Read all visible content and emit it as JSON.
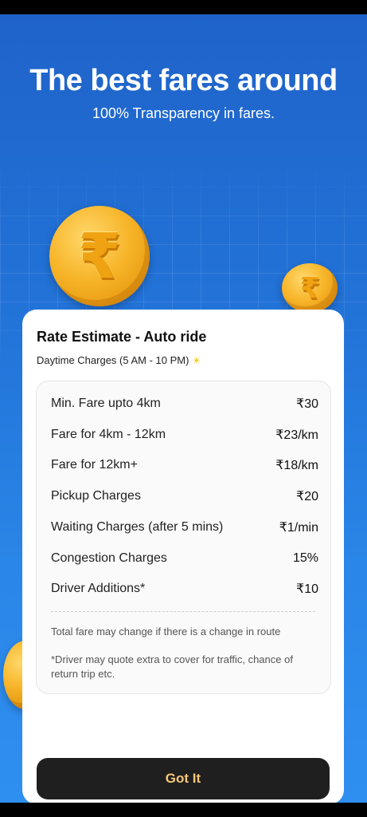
{
  "header": {
    "title": "The best fares around",
    "subtitle": "100% Transparency in fares."
  },
  "coins": {
    "symbol": "₹"
  },
  "card": {
    "title": "Rate Estimate - Auto ride",
    "subtitle": "Daytime Charges (5 AM - 10 PM)",
    "sun_icon": "sun-icon",
    "rates": [
      {
        "label": "Min. Fare upto 4km",
        "value": "₹30"
      },
      {
        "label": "Fare for 4km - 12km",
        "value": "₹23/km"
      },
      {
        "label": "Fare for 12km+",
        "value": "₹18/km"
      },
      {
        "label": "Pickup Charges",
        "value": "₹20"
      },
      {
        "label": "Waiting Charges (after 5 mins)",
        "value": "₹1/min"
      },
      {
        "label": "Congestion Charges",
        "value": "15%"
      },
      {
        "label": "Driver Additions*",
        "value": "₹10"
      }
    ],
    "note_route": "Total fare may change if there is a change in route",
    "note_driver": "*Driver may quote extra to cover for traffic, chance of return trip etc."
  },
  "button": {
    "label": "Got It"
  },
  "colors": {
    "background": "#2274d9",
    "button": "#1f1f1f",
    "button_text": "#f4c77a",
    "coin": "#f7b52a"
  }
}
